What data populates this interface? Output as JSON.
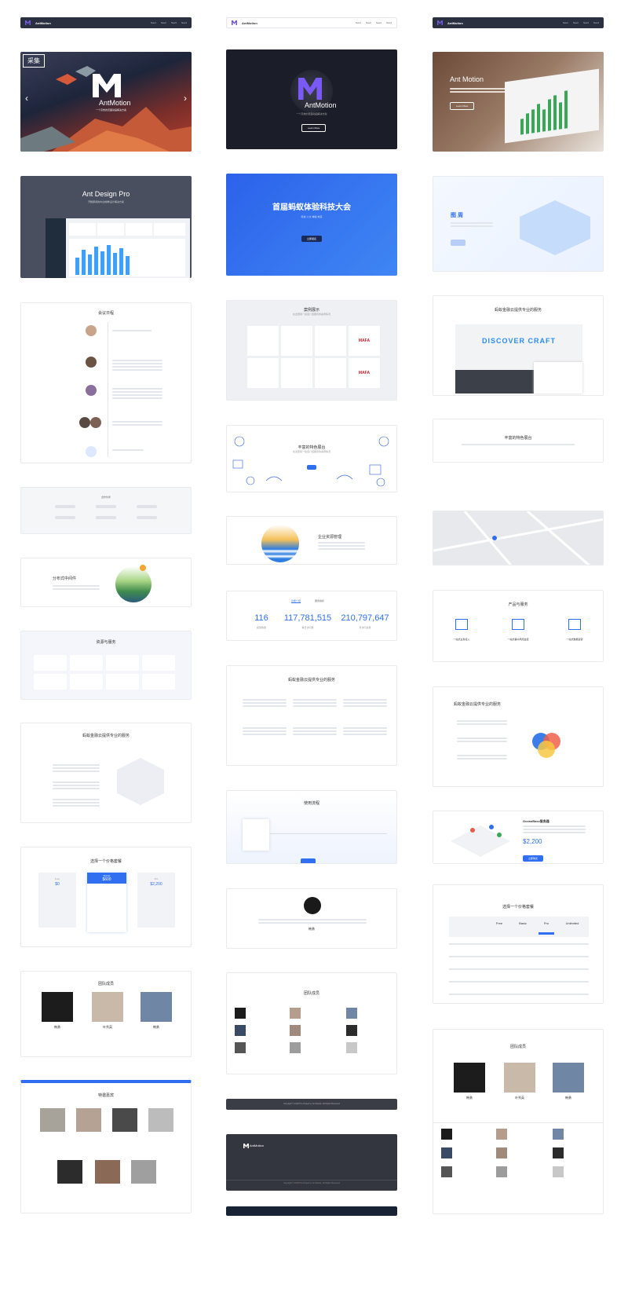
{
  "brand": {
    "name": "AntMotion",
    "short": "M"
  },
  "nav": {
    "items": [
      "Nav1",
      "Nav2",
      "Nav3",
      "Nav4"
    ]
  },
  "banner1": {
    "tag": "采集",
    "title": "AntMotion",
    "sub": "一个高效的页面动画解决方案"
  },
  "banner2": {
    "title": "AntMotion",
    "sub": "一个高效的页面动画解决方案",
    "btn": "Learn More"
  },
  "banner3": {
    "title": "Ant Motion",
    "btn": "Learn More"
  },
  "adp": {
    "title": "Ant Design Pro",
    "sub": "开箱即用的中台前端/设计解决方案"
  },
  "conf": {
    "title": "首届蚂蚁体验科技大会",
    "sub": "科技·人文·体验·未来",
    "btn": "立即报名"
  },
  "tuyuan": {
    "title": "图 周"
  },
  "timeline": {
    "title": "会议日程"
  },
  "cases": {
    "title": "案例展示",
    "sub": "在这里用一段话介绍服务的案例情况",
    "logos": [
      "MAFA",
      "MAFA"
    ]
  },
  "craft": {
    "title": "蚂蚁金融云提供专业的服务",
    "hero": "DISCOVER CRAFT"
  },
  "partners": {
    "title": "特邀嘉宾"
  },
  "specialty": {
    "title": "丰富的特色展台",
    "sub": "在这里用一段话介绍服务的案例情况"
  },
  "special2": {
    "title": "丰富的特色展台"
  },
  "distributed": {
    "title": "分布式中间件"
  },
  "erp": {
    "title": "企业资源管理"
  },
  "products": {
    "title": "产品与服务",
    "items": [
      "一站式业务接入",
      "一站式事中风险监控",
      "一站式数据运营"
    ]
  },
  "services": {
    "title": "资源与服务"
  },
  "stats": {
    "tabs": [
      "功能介绍",
      "服务指标"
    ],
    "values": [
      "116",
      "117,781,515",
      "210,797,647"
    ],
    "labels": [
      "模型数量",
      "每日访问量",
      "月访问总量"
    ]
  },
  "fin1": {
    "title": "蚂蚁金融云提供专业的服务"
  },
  "fin2": {
    "title": "蚂蚁金融云提供专业的服务"
  },
  "fin3": {
    "title": "蚂蚁金融云提供专业的服务"
  },
  "flow": {
    "title": "使用流程"
  },
  "ocean": {
    "title": "OceanBase服务器",
    "price": "$2,200",
    "btn": "立即购买"
  },
  "pricing1": {
    "title": "选择一个价格套餐",
    "plans": [
      {
        "name": "Free",
        "price": "$0"
      },
      {
        "name": "Starter",
        "price": "$600"
      },
      {
        "name": "Pro",
        "price": "$2,200"
      }
    ]
  },
  "pricing2": {
    "title": "选择一个价格套餐",
    "cols": [
      "Free",
      "Basic",
      "Pro",
      "Unlimited"
    ]
  },
  "testimonial": {
    "name": "韩勇"
  },
  "team1": {
    "title": "团队成员",
    "members": [
      "韩勇",
      "叶秀英",
      "韩勇"
    ]
  },
  "team2": {
    "title": "团队成员"
  },
  "team3": {
    "title": "团队成员",
    "members": [
      "韩勇",
      "叶秀英",
      "韩勇"
    ]
  },
  "footer": {
    "copy": "Copyright © 2018 The Project by Ant Motion. All Rights Reserved"
  },
  "colors": {
    "primary": "#2f6ff0",
    "dark": "#2b3040",
    "purple": "#6f5ad8"
  }
}
